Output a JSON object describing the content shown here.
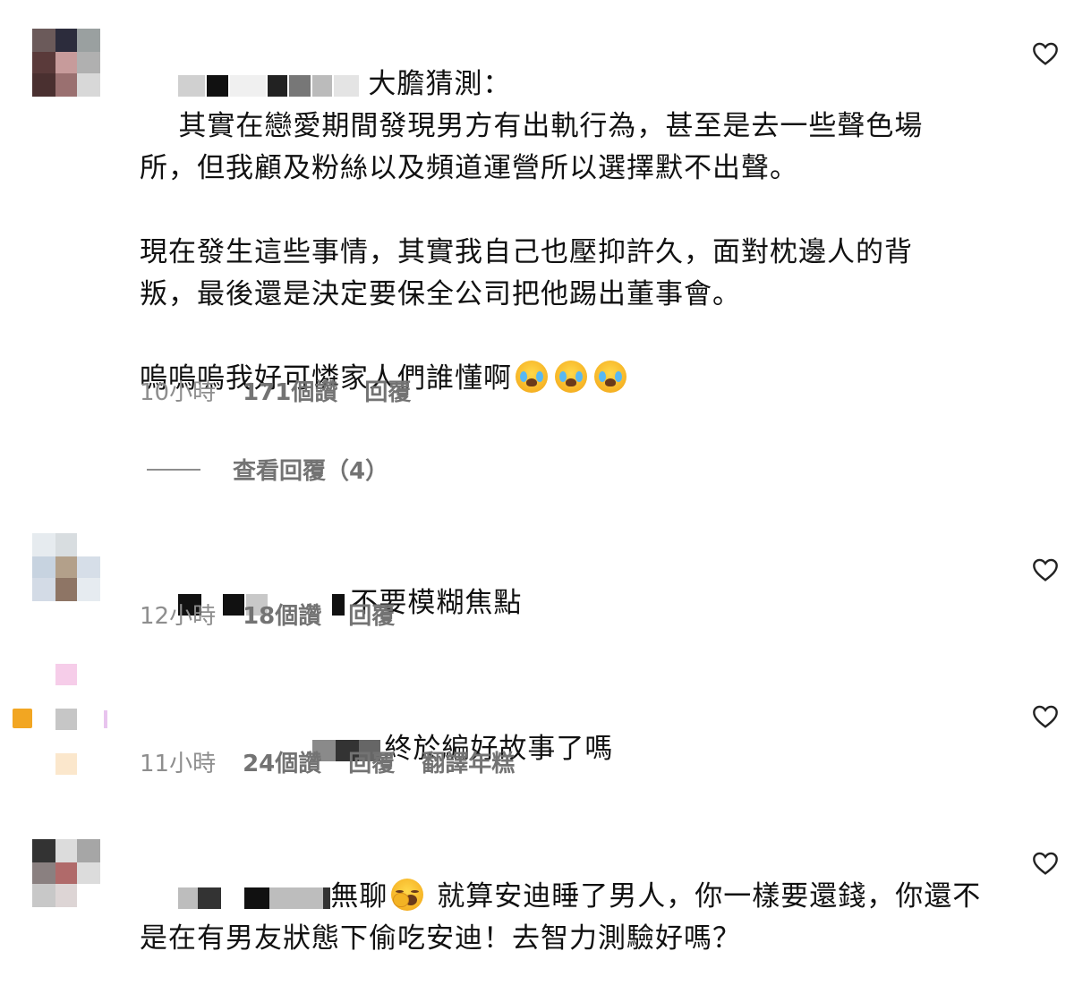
{
  "comments": [
    {
      "line1": "大膽猜測：",
      "body": "其實在戀愛期間發現男方有出軌行為，甚至是去一些聲色場\n所，但我顧及粉絲以及頻道運營所以選擇默不出聲。\n\n現在發生這些事情，其實我自己也壓抑許久，面對枕邊人的背\n叛，最後還是決定要保全公司把他踢出董事會。\n\n嗚嗚嗚我好可憐家人們誰懂啊",
      "time": "10小時",
      "likes": "171個讚",
      "reply": "回覆",
      "view_replies": "查看回覆（4）"
    },
    {
      "text": "不要模糊焦點",
      "time": "12小時",
      "likes": "18個讚",
      "reply": "回覆"
    },
    {
      "text": "終於編好故事了嗎",
      "time": "11小時",
      "likes": "24個讚",
      "reply": "回覆",
      "translate": "翻譯年糕"
    },
    {
      "text_a": "無聊",
      "text_b": " 就算安迪睡了男人，你一樣要還錢，你還不",
      "text_c": "是在有男友狀態下偷吃安迪！去智力測驗好嗎？"
    }
  ],
  "icons": {
    "heart": "heart-outline-icon",
    "crying_emoji": "loudly-crying-face",
    "yawn_emoji": "yawning-face"
  },
  "colors": {
    "text": "#111111",
    "meta": "#8e8e8e",
    "meta_bold": "#737373"
  }
}
